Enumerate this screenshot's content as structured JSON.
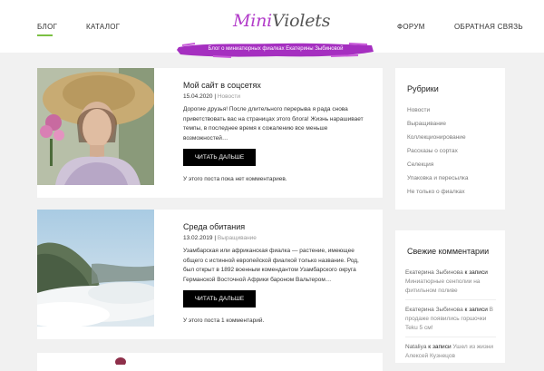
{
  "nav": {
    "blog": "БЛОГ",
    "catalog": "КАТАЛОГ",
    "forum": "ФОРУМ",
    "feedback": "ОБРАТНАЯ СВЯЗЬ"
  },
  "brand": {
    "logo_first": "Mini",
    "logo_rest": "Violets",
    "tagline": "Блог о миниатюрных фиалках Екатерины Зыбиновой",
    "accent": "#b23bc9"
  },
  "posts": [
    {
      "title": "Мой сайт в соцсетях",
      "date": "15.04.2020",
      "category": "Новости",
      "excerpt": "Дорогие друзья! После длительного перерыва я рада снова приветствовать вас на страницах этого блога! Жизнь нарашивает темпы, в последнее время к сожалению все меньше возможностей…",
      "button": "ЧИТАТЬ ДАЛЬШЕ",
      "comments": "У этого поста пока нет комментариев."
    },
    {
      "title": "Среда обитания",
      "date": "13.02.2019",
      "category": "Выращивание",
      "excerpt": "Узамбарская или африканская фиалка — растение, имеющее общего с истинной европейской фиалкой только название. Род, был открыт в 1892 военным комендантом Узамбарского округа Германской Восточной Африки бароном Вальтером…",
      "button": "ЧИТАТЬ ДАЛЬШЕ",
      "comments": "У этого поста 1 комментарий."
    }
  ],
  "sidebar": {
    "rubrics_title": "Рубрики",
    "categories": [
      "Новости",
      "Выращивание",
      "Коллекционирование",
      "Рассказы о сортах",
      "Селекция",
      "Упаковка и пересылка",
      "Не только о фиалках"
    ],
    "comments_title": "Свежие комментарии",
    "recent_comments": [
      {
        "author": "Екатерина Зыбинова",
        "on": "к записи",
        "post": "Миниатюрные сенполии на фитильном поливе"
      },
      {
        "author": "Екатерина Зыбинова",
        "on": "к записи",
        "post": "В продаже появились горшочки Teku 5 см!"
      },
      {
        "author": "Nataliya",
        "on": "к записи",
        "post": "Ушел из жизни Алексей Кузнецов"
      }
    ]
  },
  "colors": {
    "nav_underline": "#7bc043",
    "button_bg": "#000000",
    "page_bg": "#f1f1f1"
  }
}
